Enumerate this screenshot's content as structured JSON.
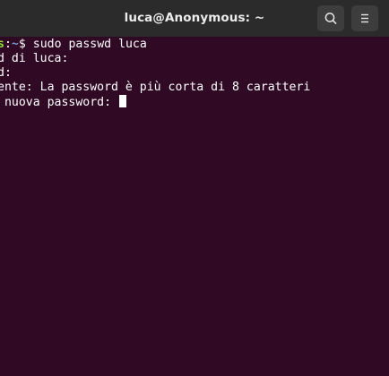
{
  "window": {
    "title": "luca@Anonymous: ~"
  },
  "toolbar": {
    "search_icon": "search-icon",
    "menu_icon": "hamburger-menu-icon"
  },
  "terminal": {
    "prompt_host_tail": "s",
    "prompt_colon": ":",
    "prompt_path": "~",
    "prompt_symbol": "$ ",
    "command": "sudo passwd luca",
    "line2": "d di luca:",
    "line3": "d:",
    "line4": "ente: La password è più corta di 8 caratteri",
    "line5": " nuova password: "
  },
  "colors": {
    "background": "#300a24",
    "titlebar": "#2b2b2b",
    "prompt_host": "#8ae234",
    "prompt_path": "#729fcf",
    "text": "#ffffff"
  }
}
